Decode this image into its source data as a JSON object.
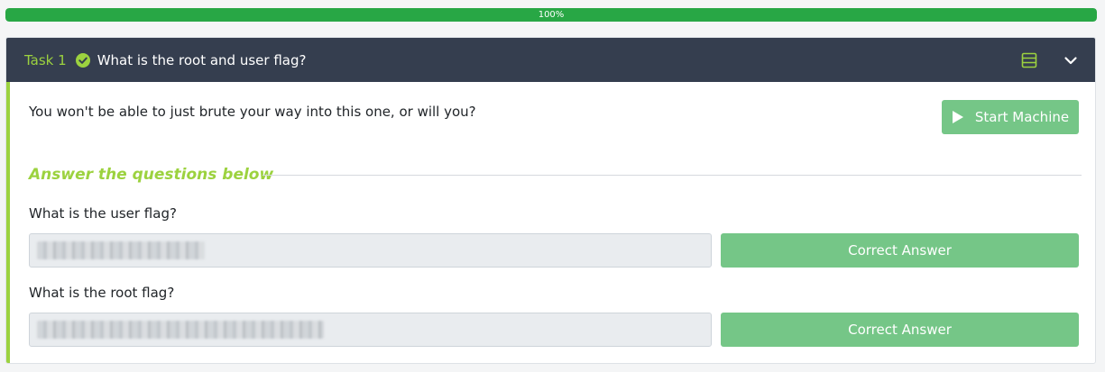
{
  "progress": {
    "label": "100%",
    "fraction": 1.0
  },
  "task": {
    "number_label": "Task 1",
    "title": "What is the root and user flag?",
    "description": "You won't be able to just brute your way into this one, or will you?",
    "start_button_label": "Start Machine",
    "answers_heading": "Answer the questions below",
    "questions": [
      {
        "label": "What is the user flag?",
        "answer_masked": "",
        "button_label": "Correct Answer"
      },
      {
        "label": "What is the root flag?",
        "answer_masked": "",
        "button_label": "Correct Answer"
      }
    ]
  },
  "colors": {
    "header_bg": "#353e4f",
    "accent_green": "#9cd23f",
    "button_green": "#75c687",
    "progress_green": "#28a745"
  },
  "icons": {
    "task_status": "check-circle-icon",
    "header_action": "list-icon",
    "collapse": "chevron-down-icon",
    "start": "play-icon"
  }
}
